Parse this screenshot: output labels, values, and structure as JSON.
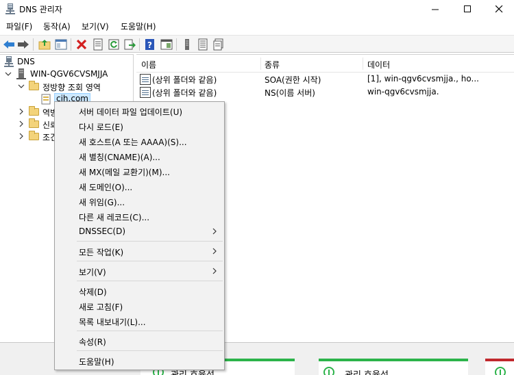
{
  "window": {
    "title": "DNS 관리자",
    "controls": {
      "minimize": "minimize-icon",
      "maximize": "maximize-icon",
      "close": "close-icon"
    }
  },
  "menubar": {
    "file": "파일(F)",
    "action": "동작(A)",
    "view": "보기(V)",
    "help": "도움말(H)"
  },
  "toolbar": {
    "icons": [
      "back-icon",
      "forward-icon",
      "up-folder-icon",
      "show-tree-icon",
      "delete-icon",
      "properties-icon",
      "refresh-icon",
      "export-icon",
      "help-icon",
      "console-icon",
      "server-icon",
      "list-icon",
      "record-icon"
    ]
  },
  "tree": {
    "root": "DNS",
    "server": "WIN-QGV6CVSMJJA",
    "forward_zones": "정방향 조회 영역",
    "zone": "cih.com",
    "reverse_zones": "역방",
    "trust_points": "신뢰",
    "conditional": "조건"
  },
  "list": {
    "columns": {
      "name": "이름",
      "type": "종류",
      "data": "데이터"
    },
    "rows": [
      {
        "name": "(상위 폴더와 같음)",
        "type": "SOA(권한 시작)",
        "data": "[1], win-qgv6cvsmjja., ho..."
      },
      {
        "name": "(상위 폴더와 같음)",
        "type": "NS(이름 서버)",
        "data": "win-qgv6cvsmjja."
      }
    ]
  },
  "context_menu": {
    "items": [
      {
        "label": "서버 데이터 파일 업데이트(U)"
      },
      {
        "label": "다시 로드(E)"
      },
      {
        "label": "새 호스트(A 또는 AAAA)(S)..."
      },
      {
        "label": "새 별칭(CNAME)(A)..."
      },
      {
        "label": "새 MX(메일 교환기)(M)..."
      },
      {
        "label": "새 도메인(O)..."
      },
      {
        "label": "새 위임(G)..."
      },
      {
        "label": "다른 새 레코드(C)..."
      },
      {
        "label": "DNSSEC(D)",
        "submenu": true
      },
      {
        "label": "모든 작업(K)",
        "submenu": true
      },
      {
        "label": "보기(V)",
        "submenu": true
      },
      {
        "label": "삭제(D)"
      },
      {
        "label": "새로 고침(F)"
      },
      {
        "label": "목록 내보내기(L)..."
      },
      {
        "label": "속성(R)"
      },
      {
        "label": "도움말(H)"
      }
    ]
  },
  "dashboard_tiles": {
    "tile1": "관리 효율성",
    "tile2": "관리 효율성"
  },
  "colors": {
    "selection": "#cce8ff",
    "tile_green": "#2cb34a",
    "tile_red": "#c0282d",
    "menu_bg": "#f2f2f2"
  }
}
